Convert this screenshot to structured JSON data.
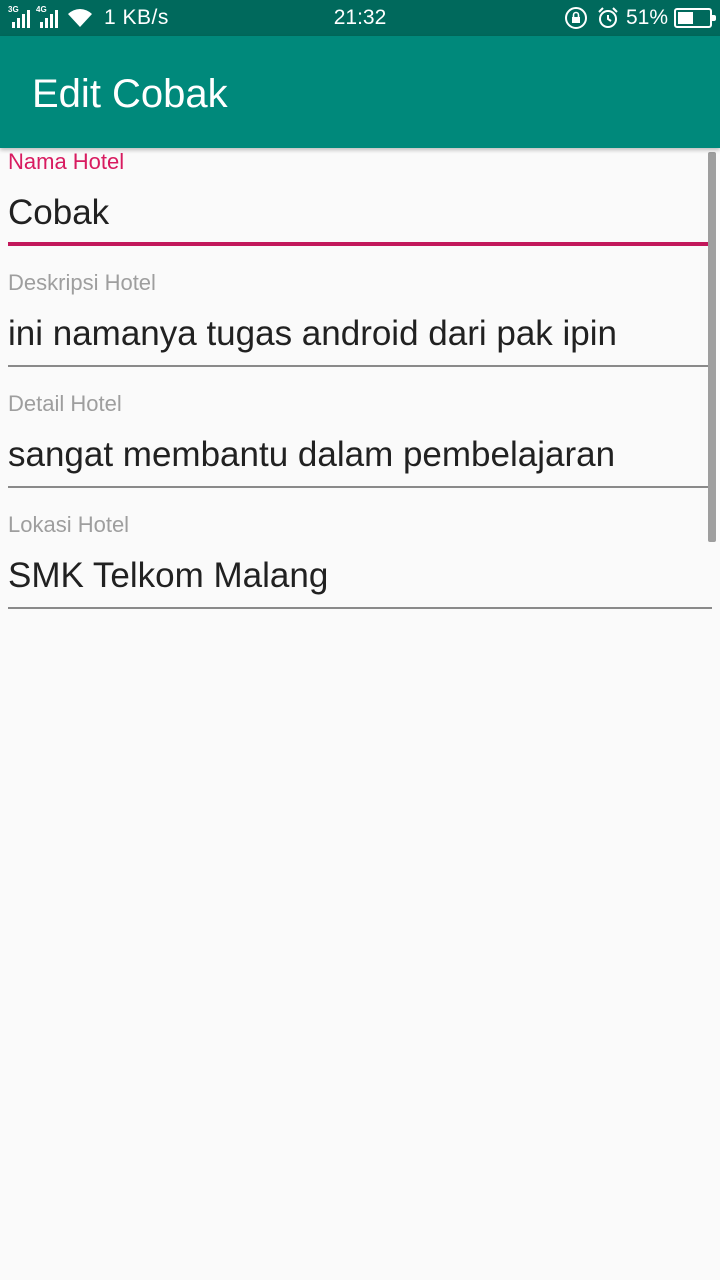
{
  "status_bar": {
    "network_1": "3G",
    "network_2": "4G",
    "speed": "1 KB/s",
    "time": "21:32",
    "battery_percent": "51%",
    "battery_level": 0.51,
    "icons": [
      "signal-icon",
      "signal-icon",
      "wifi-icon",
      "rotation-lock-icon",
      "alarm-icon",
      "battery-icon"
    ]
  },
  "app_bar": {
    "title": "Edit Cobak",
    "color": "#00897b"
  },
  "form": {
    "fields": [
      {
        "label": "Nama Hotel",
        "value": "Cobak",
        "focused": true
      },
      {
        "label": "Deskripsi Hotel",
        "value": "ini namanya tugas android dari pak ipin",
        "focused": false
      },
      {
        "label": "Detail Hotel",
        "value": "sangat membantu dalam pembelajaran",
        "focused": false
      },
      {
        "label": "Lokasi Hotel",
        "value": "SMK Telkom Malang",
        "focused": false
      }
    ]
  },
  "colors": {
    "accent": "#d81b60",
    "primary_dark": "#00695c"
  }
}
